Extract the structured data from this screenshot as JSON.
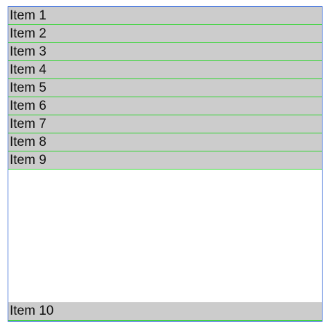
{
  "list": {
    "items": [
      {
        "label": "Item 1"
      },
      {
        "label": "Item 2"
      },
      {
        "label": "Item 3"
      },
      {
        "label": "Item 4"
      },
      {
        "label": "Item 5"
      },
      {
        "label": "Item 6"
      },
      {
        "label": "Item 7"
      },
      {
        "label": "Item 8"
      },
      {
        "label": "Item 9"
      },
      {
        "label": "Item 10"
      }
    ]
  },
  "colors": {
    "frame_border": "#3f6fd8",
    "item_background": "#cccccc",
    "item_separator": "#29d629",
    "text": "#111111",
    "page_background": "#ffffff"
  }
}
